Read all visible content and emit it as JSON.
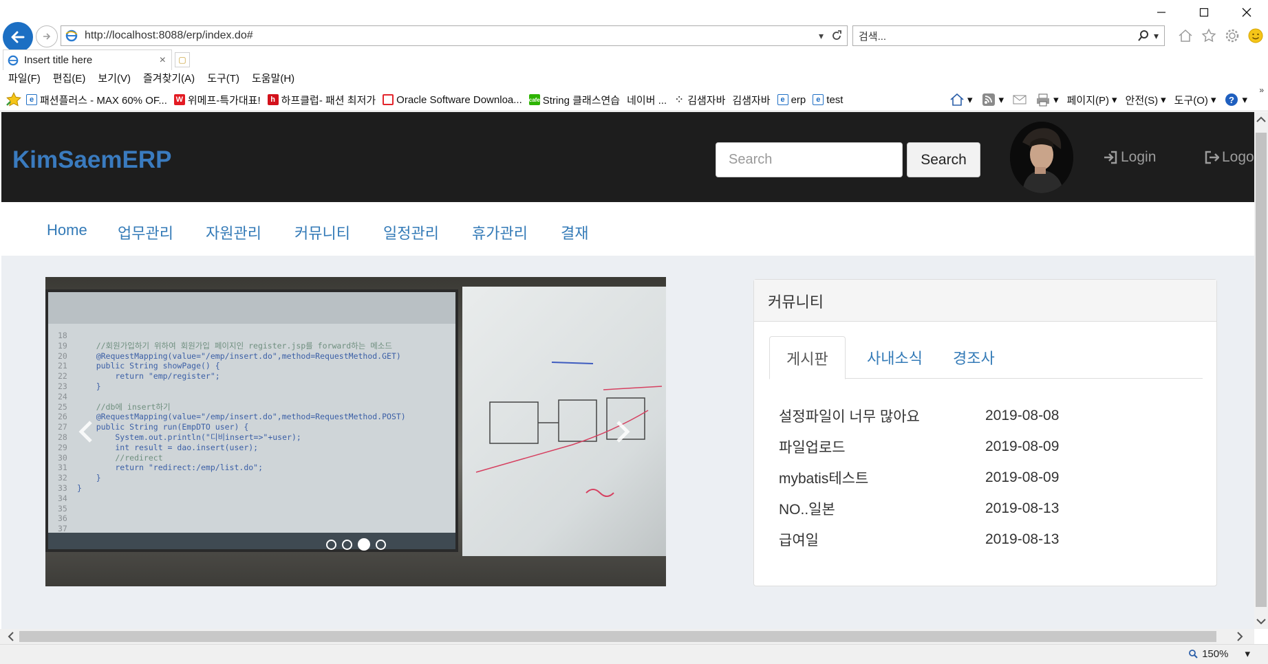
{
  "browser": {
    "url": "http://localhost:8088/erp/index.do#",
    "search_placeholder": "검색...",
    "tab_title": "Insert title here",
    "tab_close": "×",
    "menu": [
      "파일(F)",
      "편집(E)",
      "보기(V)",
      "즐겨찾기(A)",
      "도구(T)",
      "도움말(H)"
    ],
    "favorites": [
      {
        "label": "패션플러스 - MAX 60% OF...",
        "icon": "ie-page-icon",
        "color": "#1f6fc5"
      },
      {
        "label": "위메프-특가대표!",
        "icon": "wemakeprice-icon",
        "color": "#e31b23"
      },
      {
        "label": "하프클럽- 패션 최저가",
        "icon": "halfclub-icon",
        "color": "#d3111b"
      },
      {
        "label": "Oracle Software Downloa...",
        "icon": "oracle-icon",
        "color": "#e3242b"
      },
      {
        "label": "String 클래스연습",
        "icon": "naver-cafe-icon",
        "color": "#2db400"
      },
      {
        "label": "네이버 ...",
        "icon": "none",
        "color": ""
      },
      {
        "label": "김샘자바",
        "icon": "dots-icon",
        "color": ""
      },
      {
        "label": "김샘자바",
        "icon": "none",
        "color": ""
      },
      {
        "label": "erp",
        "icon": "ie-page-icon",
        "color": "#1f6fc5"
      },
      {
        "label": "test",
        "icon": "ie-page-icon",
        "color": "#1f6fc5"
      }
    ],
    "command_bar": {
      "page": "페이지(P)",
      "safety": "안전(S)",
      "tools": "도구(O)"
    },
    "zoom": "150%"
  },
  "site": {
    "brand": "KimSaemERP",
    "search_placeholder": "Search",
    "search_button": "Search",
    "login": "Login",
    "logout": "Logo",
    "menu": [
      "Home",
      "업무관리",
      "자원관리",
      "커뮤니티",
      "일정관리",
      "휴가관리",
      "결재"
    ]
  },
  "carousel": {
    "slide_count": 4,
    "active_index": 2,
    "code_lines": [
      {
        "n": "18",
        "t": ""
      },
      {
        "n": "19",
        "t": "    //회원가입하기 위하여 회원가입 페이지인 register.jsp를 forward하는 메소드"
      },
      {
        "n": "20",
        "t": "    @RequestMapping(value=\"/emp/insert.do\",method=RequestMethod.GET)"
      },
      {
        "n": "21",
        "t": "    public String showPage() {"
      },
      {
        "n": "22",
        "t": "        return \"emp/register\";"
      },
      {
        "n": "23",
        "t": "    }"
      },
      {
        "n": "24",
        "t": ""
      },
      {
        "n": "25",
        "t": "    //db에 insert하기"
      },
      {
        "n": "26",
        "t": "    @RequestMapping(value=\"/emp/insert.do\",method=RequestMethod.POST)"
      },
      {
        "n": "27",
        "t": "    public String run(EmpDTO user) {"
      },
      {
        "n": "28",
        "t": "        System.out.println(\"디비insert=>\"+user);"
      },
      {
        "n": "29",
        "t": "        int result = dao.insert(user);"
      },
      {
        "n": "30",
        "t": "        //redirect"
      },
      {
        "n": "31",
        "t": "        return \"redirect:/emp/list.do\";"
      },
      {
        "n": "32",
        "t": "    }"
      },
      {
        "n": "33",
        "t": "}"
      },
      {
        "n": "34",
        "t": ""
      },
      {
        "n": "35",
        "t": ""
      },
      {
        "n": "36",
        "t": ""
      },
      {
        "n": "37",
        "t": ""
      }
    ]
  },
  "community": {
    "heading": "커뮤니티",
    "tabs": [
      "게시판",
      "사내소식",
      "경조사"
    ],
    "active_tab": 0,
    "posts": [
      {
        "title": "설정파일이 너무 많아요",
        "date": "2019-08-08"
      },
      {
        "title": "파일업로드",
        "date": "2019-08-09"
      },
      {
        "title": "mybatis테스트",
        "date": "2019-08-09"
      },
      {
        "title": "NO..일본",
        "date": "2019-08-13"
      },
      {
        "title": "급여일",
        "date": "2019-08-13"
      }
    ]
  }
}
